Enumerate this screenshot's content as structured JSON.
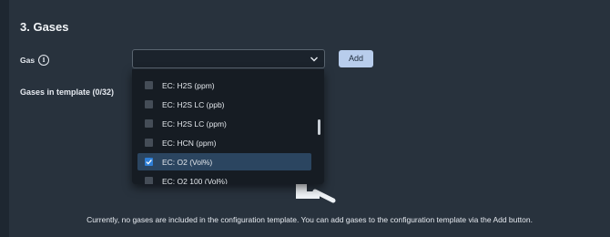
{
  "section": {
    "title": "3. Gases"
  },
  "gas_field": {
    "label": "Gas",
    "info_icon": "info-icon",
    "select_value": "",
    "chevron_icon": "chevron-down-icon"
  },
  "add_button": {
    "label": "Add"
  },
  "template_list": {
    "label": "Gases in template (0/32)"
  },
  "empty_state": {
    "illustration_icon": "magnifier-icon",
    "message": "Currently, no gases are included in the configuration template. You can add gases to the configuration template via the Add button."
  },
  "dropdown": {
    "options": [
      {
        "label": "EC: H2S (ppm)",
        "checked": false
      },
      {
        "label": "EC: H2S LC (ppb)",
        "checked": false
      },
      {
        "label": "EC: H2S LC (ppm)",
        "checked": false
      },
      {
        "label": "EC: HCN (ppm)",
        "checked": false
      },
      {
        "label": "EC: O2 (Vol%)",
        "checked": true
      },
      {
        "label": "EC: O2 100 (Vol%)",
        "checked": false
      }
    ]
  },
  "colors": {
    "background": "#1e2731",
    "panel": "#28323d",
    "accent": "#b8cdec",
    "checkbox_checked": "#2f7fd6",
    "selected_row": "#2b4560"
  }
}
